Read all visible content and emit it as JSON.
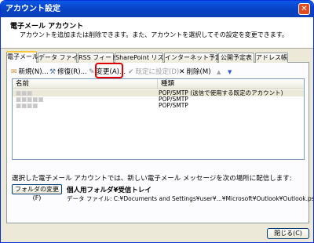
{
  "window": {
    "title": "アカウント設定",
    "close_glyph": "✕"
  },
  "header": {
    "title": "電子メール アカウント",
    "subtitle": "アカウントを追加または削除できます。また、アカウントを選択してその設定を変更できます。"
  },
  "tabs": [
    {
      "label": "電子メール"
    },
    {
      "label": "データ ファイル"
    },
    {
      "label": "RSS フィード"
    },
    {
      "label": "SharePoint リスト"
    },
    {
      "label": "インターネット予定表"
    },
    {
      "label": "公開予定表"
    },
    {
      "label": "アドレス帳"
    }
  ],
  "toolbar": {
    "new_label": "新規(N)...",
    "repair_label": "修復(R)...",
    "change_label": "変更(A)...",
    "default_label": "既定に設定(D)",
    "delete_label": "削除(M)",
    "up_glyph": "▲",
    "down_glyph": "▼"
  },
  "list": {
    "col_name": "名前",
    "col_type": "種類",
    "rows": [
      {
        "type": "POP/SMTP (送信で使用する既定のアカウント)"
      },
      {
        "type": "POP/SMTP"
      },
      {
        "type": "POP/SMTP"
      }
    ]
  },
  "delivery": {
    "info": "選択した電子メール アカウントでは、新しい電子メール メッセージを次の場所に配信します:",
    "folder_button": "フォルダの変更(F)",
    "folder_name": "個人用フォルダ¥受信トレイ",
    "data_file": "データ ファイル: C:¥Documents and Settings¥user¥...¥Microsoft¥Outlook¥Outlook.pst"
  },
  "footer": {
    "close_label": "閉じる(C)"
  }
}
